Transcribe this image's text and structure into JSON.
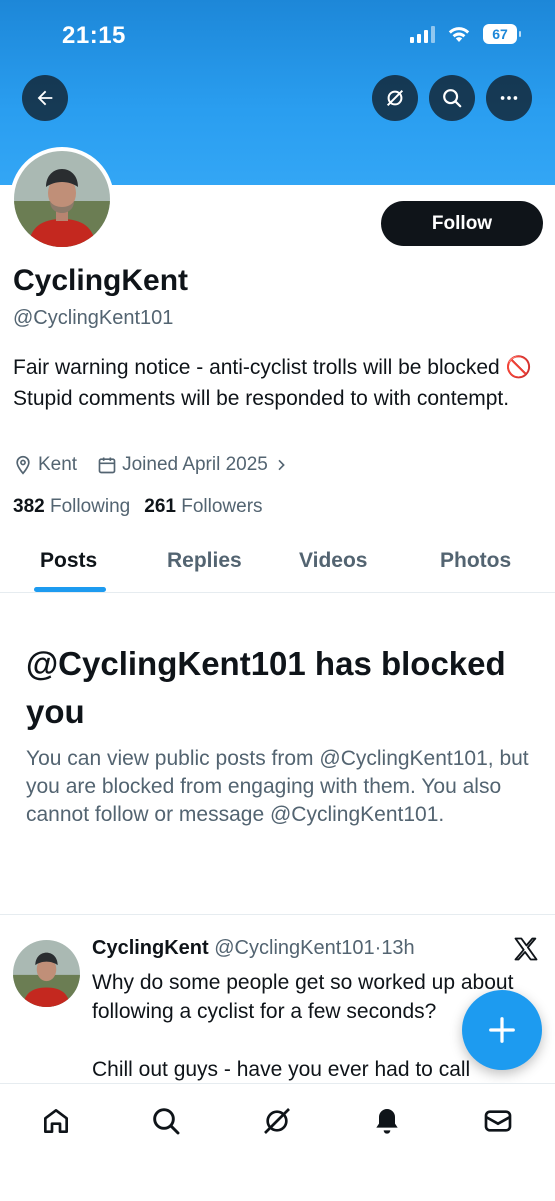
{
  "status_bar": {
    "time": "21:15",
    "battery": "67"
  },
  "header": {
    "back": "back-arrow-icon",
    "actions": [
      "grok-icon",
      "search-icon",
      "more-icon"
    ]
  },
  "profile": {
    "name": "CyclingKent",
    "handle": "@CyclingKent101",
    "follow_label": "Follow",
    "bio": "Fair warning notice - anti-cyclist trolls will be blocked 🚫 Stupid comments will be responded to with contempt.",
    "location": "Kent",
    "joined": "Joined April 2025",
    "following_count": "382",
    "following_label": "Following",
    "followers_count": "261",
    "followers_label": "Followers"
  },
  "tabs": [
    {
      "label": "Posts",
      "active": true
    },
    {
      "label": "Replies",
      "active": false
    },
    {
      "label": "Videos",
      "active": false
    },
    {
      "label": "Photos",
      "active": false
    }
  ],
  "blocked": {
    "title": "@CyclingKent101 has blocked you",
    "message": "You can view public posts from @CyclingKent101, but you are blocked from engaging with them. You also cannot follow or message @CyclingKent101."
  },
  "post": {
    "author": "CyclingKent",
    "handle": "@CyclingKent101",
    "separator": "·",
    "time": "13h",
    "text": "Why do some people get so worked up about following a cyclist for a few seconds?\n\nChill out guys - have you ever had to call"
  },
  "bottom_nav": [
    "home-icon",
    "search-icon",
    "grok-icon",
    "notifications-icon",
    "messages-icon"
  ],
  "colors": {
    "accent": "#1d9bf0",
    "text": "#0f1419",
    "muted": "#536471"
  }
}
